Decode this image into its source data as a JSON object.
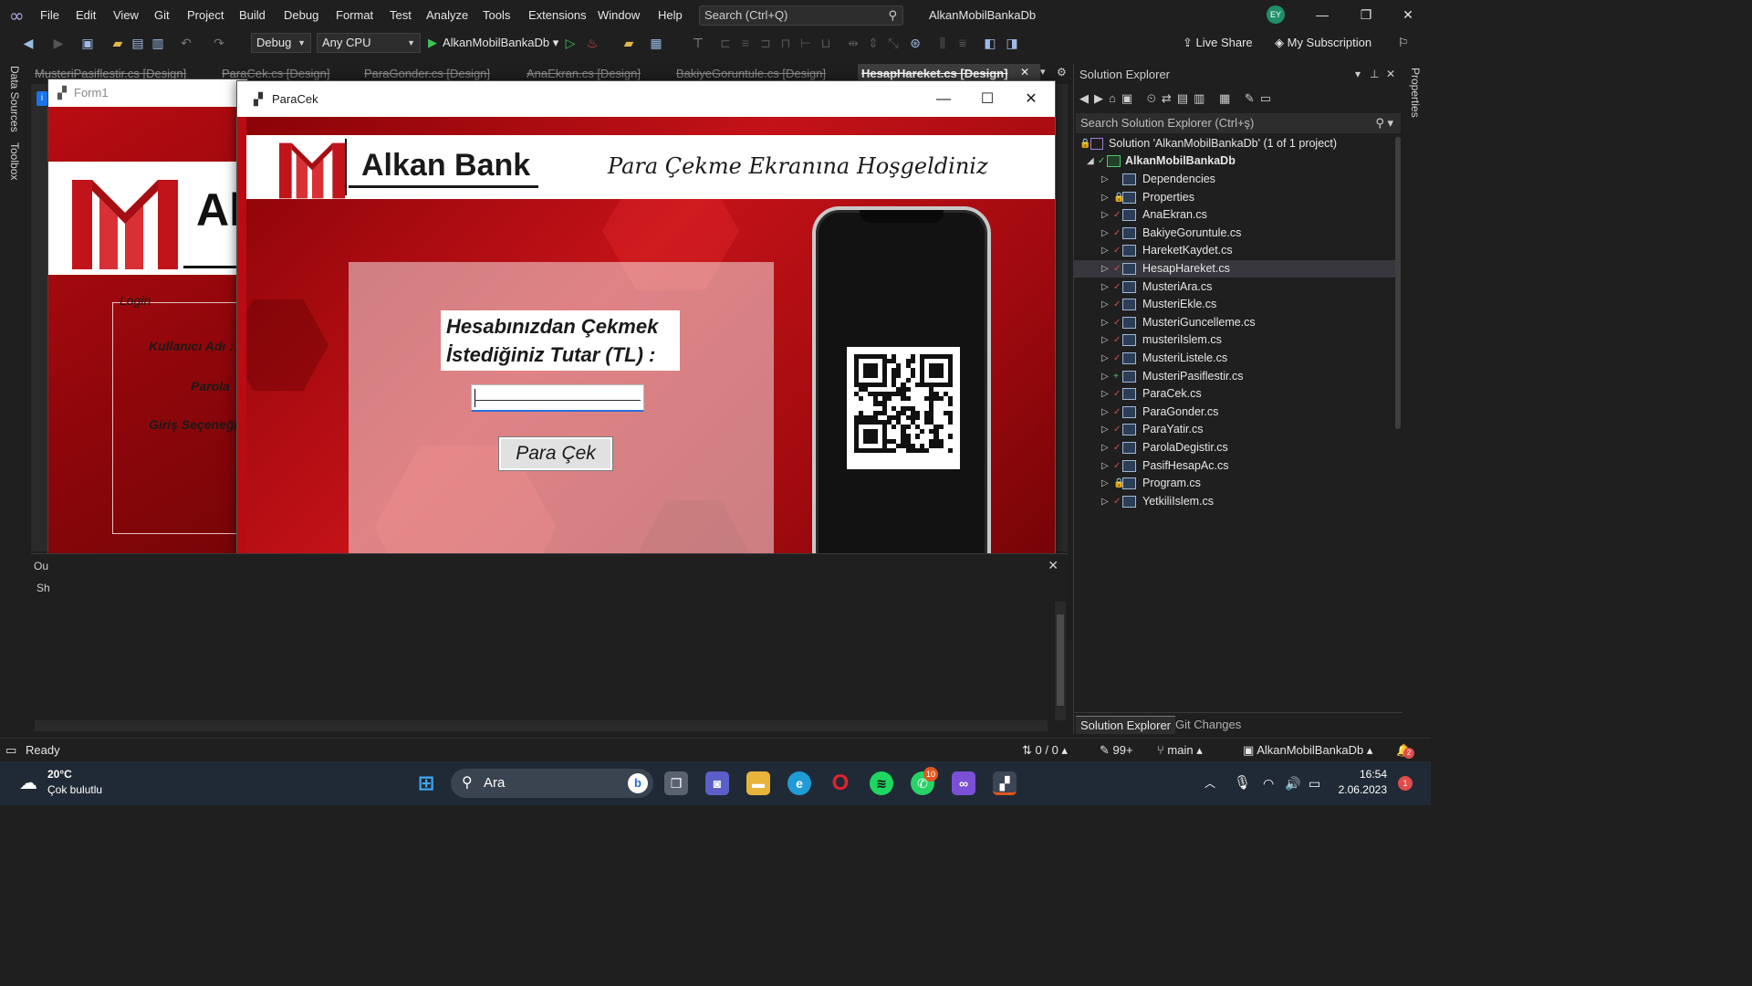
{
  "menubar": {
    "items": [
      "File",
      "Edit",
      "View",
      "Git",
      "Project",
      "Build",
      "Debug",
      "Format",
      "Test",
      "Analyze",
      "Tools",
      "Extensions",
      "Window",
      "Help"
    ],
    "search_placeholder": "Search (Ctrl+Q)",
    "app_title": "AlkanMobilBankaDb",
    "avatar_initials": "EY"
  },
  "toolbar": {
    "config": "Debug",
    "platform": "Any CPU",
    "run_target": "AlkanMobilBankaDb",
    "live_share": "Live Share",
    "subscription": "My Subscription"
  },
  "side_left": {
    "data_sources": "Data Sources",
    "toolbox": "Toolbox"
  },
  "side_right": {
    "properties": "Properties"
  },
  "tabs": [
    {
      "label": "MusteriPasiflestir.cs [Design]",
      "active": false
    },
    {
      "label": "ParaCek.cs [Design]",
      "active": false
    },
    {
      "label": "ParaGonder.cs [Design]",
      "active": false
    },
    {
      "label": "AnaEkran.cs [Design]",
      "active": false
    },
    {
      "label": "BakiyeGoruntule.cs [Design]",
      "active": false
    },
    {
      "label": "HesapHareket.cs [Design]",
      "active": true
    }
  ],
  "form1": {
    "title": "Form1",
    "bank_partial": "Al",
    "login_legend": "Login",
    "labels": [
      "Kullanıcı Adı :",
      "Parola",
      "Giriş Seçeneği"
    ]
  },
  "paracek": {
    "title": "ParaCek",
    "bank_name": "Alkan Bank",
    "welcome": "Para Çekme Ekranına Hoşgeldiniz",
    "prompt": "Hesabınızdan Çekmek\nİstediğiniz Tutar (TL) :",
    "amount_value": "",
    "button_label": "Para Çek"
  },
  "output": {
    "label_partial": "Ou",
    "show_partial": "Sh"
  },
  "solution_explorer": {
    "title": "Solution Explorer",
    "search_placeholder": "Search Solution Explorer (Ctrl+ş)",
    "solution_label": "Solution 'AlkanMobilBankaDb' (1 of 1 project)",
    "project": "AlkanMobilBankaDb",
    "items": [
      {
        "name": "Dependencies",
        "status": ""
      },
      {
        "name": "Properties",
        "status": "lock"
      },
      {
        "name": "AnaEkran.cs",
        "status": "check"
      },
      {
        "name": "BakiyeGoruntule.cs",
        "status": "check"
      },
      {
        "name": "HareketKaydet.cs",
        "status": "check"
      },
      {
        "name": "HesapHareket.cs",
        "status": "check",
        "selected": true
      },
      {
        "name": "MusteriAra.cs",
        "status": "check"
      },
      {
        "name": "MusteriEkle.cs",
        "status": "check"
      },
      {
        "name": "MusteriGuncelleme.cs",
        "status": "check"
      },
      {
        "name": "musteriIslem.cs",
        "status": "check"
      },
      {
        "name": "MusteriListele.cs",
        "status": "check"
      },
      {
        "name": "MusteriPasiflestir.cs",
        "status": "plus"
      },
      {
        "name": "ParaCek.cs",
        "status": "check"
      },
      {
        "name": "ParaGonder.cs",
        "status": "check"
      },
      {
        "name": "ParaYatir.cs",
        "status": "check"
      },
      {
        "name": "ParolaDegistir.cs",
        "status": "check"
      },
      {
        "name": "PasifHesapAc.cs",
        "status": "check"
      },
      {
        "name": "Program.cs",
        "status": "lock"
      },
      {
        "name": "YetkiliIslem.cs",
        "status": "check"
      }
    ],
    "bottom_tabs": [
      "Solution Explorer",
      "Git Changes"
    ]
  },
  "statusbar": {
    "state": "Ready",
    "errors": "0 / 0",
    "edits": "99+",
    "branch": "main",
    "repo": "AlkanMobilBankaDb",
    "notifications": "2"
  },
  "taskbar": {
    "temperature": "20°C",
    "weather": "Çok bulutlu",
    "search": "Ara",
    "whatsapp_badge": "10",
    "time": "16:54",
    "date": "2.06.2023",
    "notification_count": "1"
  },
  "colors": {
    "vs_accent": "#b4a0e6",
    "bank_red": "#b80c12",
    "selection": "#37373d",
    "focus_blue": "#2b6fd6"
  }
}
